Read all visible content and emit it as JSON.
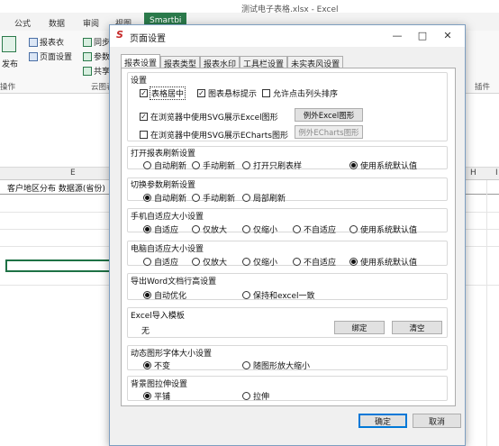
{
  "window": {
    "title": "测试电子表格.xlsx - Excel"
  },
  "ribbon_tabs": [
    "公式",
    "数据",
    "审阅",
    "视图",
    "Smartbi"
  ],
  "ribbon": {
    "publish_label": "发布",
    "report_table_label": "报表衣",
    "page_setup_label": "页面设置",
    "item_a": "同步",
    "item_b": "参数",
    "item_c": "共享",
    "group_left": "操作",
    "group_cloud": "云图表",
    "group_plugin": "插件"
  },
  "sheet": {
    "columns": [
      "E",
      "H",
      "I"
    ],
    "row1_text": "客户地区分布 数据源(省份)"
  },
  "dialog": {
    "title": "页面设置",
    "tabs": [
      "报表设置",
      "报表类型",
      "报表水印",
      "工具栏设置",
      "未实表风设置"
    ],
    "settings": {
      "title": "设置",
      "opt_center": "表格居中",
      "opt_chart_tip": "图表悬标提示",
      "opt_sort": "允许点击列头排序",
      "opt_svg_excel": "在浏览器中使用SVG展示Excel图形",
      "btn_excel_chart": "例外Excel图形",
      "opt_svg_echarts": "在浏览器中使用SVG展示ECharts图形",
      "btn_echarts_chart": "例外ECharts图形"
    },
    "open_refresh": {
      "title": "打开报表刷新设置",
      "options": [
        "自动刷新",
        "手动刷新",
        "打开只刷表样",
        "使用系统默认值"
      ]
    },
    "switch_refresh": {
      "title": "切换参数刷新设置",
      "options": [
        "自动刷新",
        "手动刷新",
        "局部刷新"
      ]
    },
    "mobile_fit": {
      "title": "手机自适应大小设置",
      "options": [
        "自适应",
        "仅放大",
        "仅缩小",
        "不自适应",
        "使用系统默认值"
      ]
    },
    "pc_fit": {
      "title": "电脑自适应大小设置",
      "options": [
        "自适应",
        "仅放大",
        "仅缩小",
        "不自适应",
        "使用系统默认值"
      ]
    },
    "word_export": {
      "title": "导出Word文档行高设置",
      "options": [
        "自动优化",
        "保持和excel一致"
      ]
    },
    "excel_import": {
      "title": "Excel导入模板",
      "value": "无",
      "btn_bind": "绑定",
      "btn_clear": "清空"
    },
    "font_size": {
      "title": "动态图形字体大小设置",
      "options": [
        "不变",
        "随图形放大缩小"
      ]
    },
    "bg_stretch": {
      "title": "背景图拉伸设置",
      "options": [
        "平铺",
        "拉伸"
      ]
    },
    "buttons": {
      "ok": "确定",
      "cancel": "取消"
    }
  }
}
